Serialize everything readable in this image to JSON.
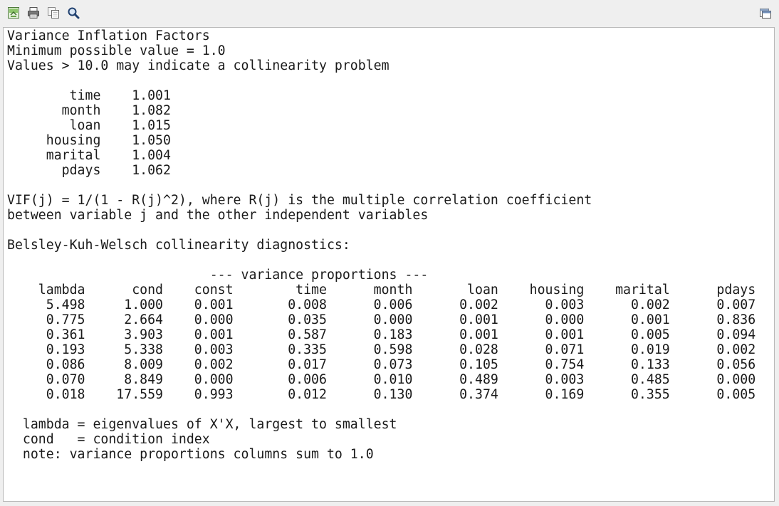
{
  "toolbar": {
    "icons": [
      "save-icon",
      "print-icon",
      "copy-icon",
      "search-icon",
      "window-restore-icon"
    ]
  },
  "output": {
    "lines": [
      "Variance Inflation Factors",
      "Minimum possible value = 1.0",
      "Values > 10.0 may indicate a collinearity problem",
      "",
      "        time    1.001",
      "       month    1.082",
      "        loan    1.015",
      "     housing    1.050",
      "     marital    1.004",
      "       pdays    1.062",
      "",
      "VIF(j) = 1/(1 - R(j)^2), where R(j) is the multiple correlation coefficient",
      "between variable j and the other independent variables",
      "",
      "Belsley-Kuh-Welsch collinearity diagnostics:",
      "",
      "                          --- variance proportions ---",
      "    lambda      cond    const        time      month       loan    housing    marital      pdays",
      "     5.498     1.000    0.001       0.008      0.006      0.002      0.003      0.002      0.007",
      "     0.775     2.664    0.000       0.035      0.000      0.001      0.000      0.001      0.836",
      "     0.361     3.903    0.001       0.587      0.183      0.001      0.001      0.005      0.094",
      "     0.193     5.338    0.003       0.335      0.598      0.028      0.071      0.019      0.002",
      "     0.086     8.009    0.002       0.017      0.073      0.105      0.754      0.133      0.056",
      "     0.070     8.849    0.000       0.006      0.010      0.489      0.003      0.485      0.000",
      "     0.018    17.559    0.993       0.012      0.130      0.374      0.169      0.355      0.005",
      "",
      "  lambda = eigenvalues of X'X, largest to smallest",
      "  cond   = condition index",
      "  note: variance proportions columns sum to 1.0"
    ]
  }
}
